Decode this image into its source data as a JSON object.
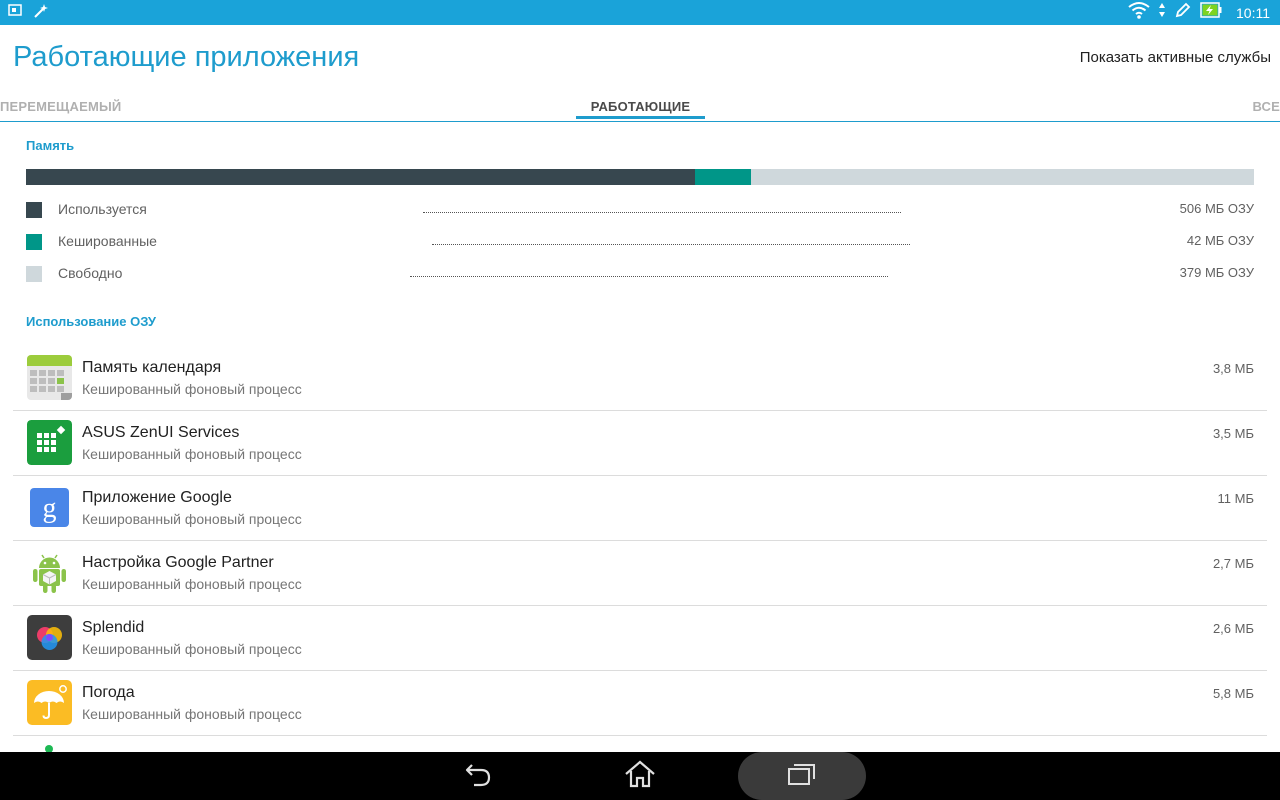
{
  "status_bar": {
    "time": "10:11",
    "left_icons": [
      "screenshot-icon",
      "magic-wand-icon"
    ],
    "right_icons": [
      "wifi-icon",
      "data-arrows-icon",
      "pen-icon",
      "battery-charging-icon"
    ]
  },
  "header": {
    "title": "Работающие приложения",
    "action": "Показать активные службы"
  },
  "tabs": [
    {
      "label": "ПЕРЕМЕЩАЕМЫЙ"
    },
    {
      "label": "РАБОТАЮЩИЕ",
      "active": true
    },
    {
      "label": "ВСЕ"
    }
  ],
  "memory": {
    "title": "Память",
    "used_fraction": 0.545,
    "cached_fraction": 0.045,
    "colors": {
      "used": "#37474f",
      "cached": "#009688",
      "free": "#cfd8dc"
    },
    "legend": [
      {
        "label": "Используется",
        "value": "506 МБ ОЗУ"
      },
      {
        "label": "Кешированные",
        "value": "42 МБ ОЗУ"
      },
      {
        "label": "Свободно",
        "value": "379 МБ ОЗУ"
      }
    ]
  },
  "ram_usage": {
    "title": "Использование ОЗУ",
    "apps": [
      {
        "name": "Память календаря",
        "sub": "Кешированный фоновый процесс",
        "size": "3,8 МБ",
        "icon": "calendar-storage-icon"
      },
      {
        "name": "ASUS ZenUI Services",
        "sub": "Кешированный фоновый процесс",
        "size": "3,5 МБ",
        "icon": "zenui-services-icon"
      },
      {
        "name": "Приложение Google",
        "sub": "Кешированный фоновый процесс",
        "size": "11 МБ",
        "icon": "google-app-icon"
      },
      {
        "name": "Настройка Google Partner",
        "sub": "Кешированный фоновый процесс",
        "size": "2,7 МБ",
        "icon": "android-partner-icon"
      },
      {
        "name": "Splendid",
        "sub": "Кешированный фоновый процесс",
        "size": "2,6 МБ",
        "icon": "splendid-icon"
      },
      {
        "name": "Погода",
        "sub": "Кешированный фоновый процесс",
        "size": "5,8 МБ",
        "icon": "weather-umbrella-icon"
      }
    ]
  },
  "nav_bar": {
    "buttons": [
      "back-icon",
      "home-icon",
      "recent-apps-icon"
    ]
  }
}
